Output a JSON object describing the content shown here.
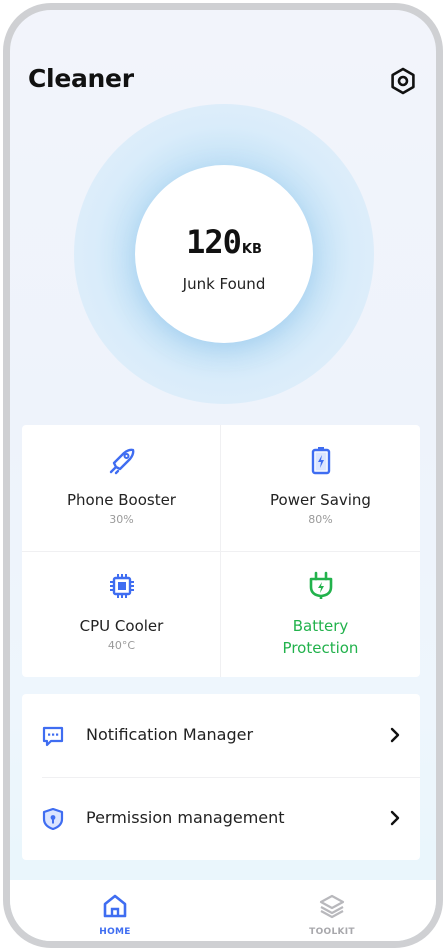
{
  "header": {
    "title": "Cleaner",
    "settings_icon": "settings-hexagon-icon"
  },
  "scan": {
    "size": "120",
    "unit": "KB",
    "label": "Junk Found"
  },
  "colors": {
    "accent": "#3f6df1",
    "green": "#22b24c",
    "muted": "#9a9a9a",
    "text": "#222222"
  },
  "features": [
    {
      "name": "Phone Booster",
      "value": "30%",
      "icon": "rocket-icon"
    },
    {
      "name": "Power Saving",
      "value": "80%",
      "icon": "battery-icon"
    },
    {
      "name": "CPU Cooler",
      "value": "40°C",
      "icon": "cpu-chip-icon"
    },
    {
      "name": "Battery\nProtection",
      "value": "",
      "icon": "charging-plug-icon"
    }
  ],
  "list": [
    {
      "label": "Notification Manager",
      "icon": "message-icon"
    },
    {
      "label": "Permission management",
      "icon": "shield-lock-icon"
    }
  ],
  "nav": [
    {
      "label": "HOME",
      "icon": "home-icon",
      "active": true
    },
    {
      "label": "TOOLKIT",
      "icon": "layers-icon",
      "active": false
    }
  ]
}
